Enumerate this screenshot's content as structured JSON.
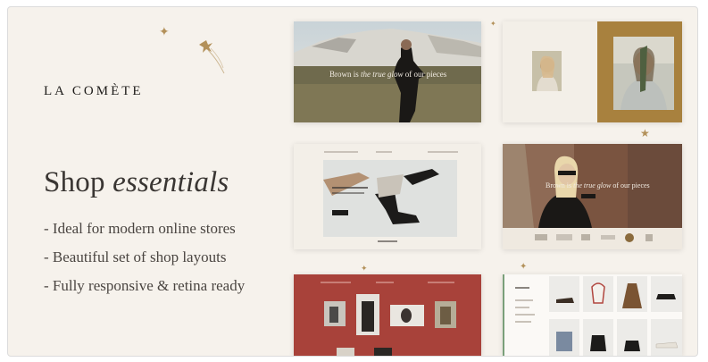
{
  "brand": "LA COMÈTE",
  "headline": {
    "regular": "Shop",
    "italic": "essentials"
  },
  "features": [
    "- Ideal for modern online stores",
    "- Beautiful set of shop layouts",
    "- Fully responsive & retina ready"
  ],
  "preview_headlines": {
    "hero_1": {
      "pre": "Brown is ",
      "italic": "the true glow",
      "post": " of our pieces"
    },
    "hero_2": {
      "pre": "Brown is ",
      "italic": "the true glow",
      "post": " of our pieces"
    }
  },
  "colors": {
    "background": "#f6f2ec",
    "accent_gold": "#b3915a",
    "terracotta": "#a8423a",
    "olive_gold": "#a8813e"
  }
}
